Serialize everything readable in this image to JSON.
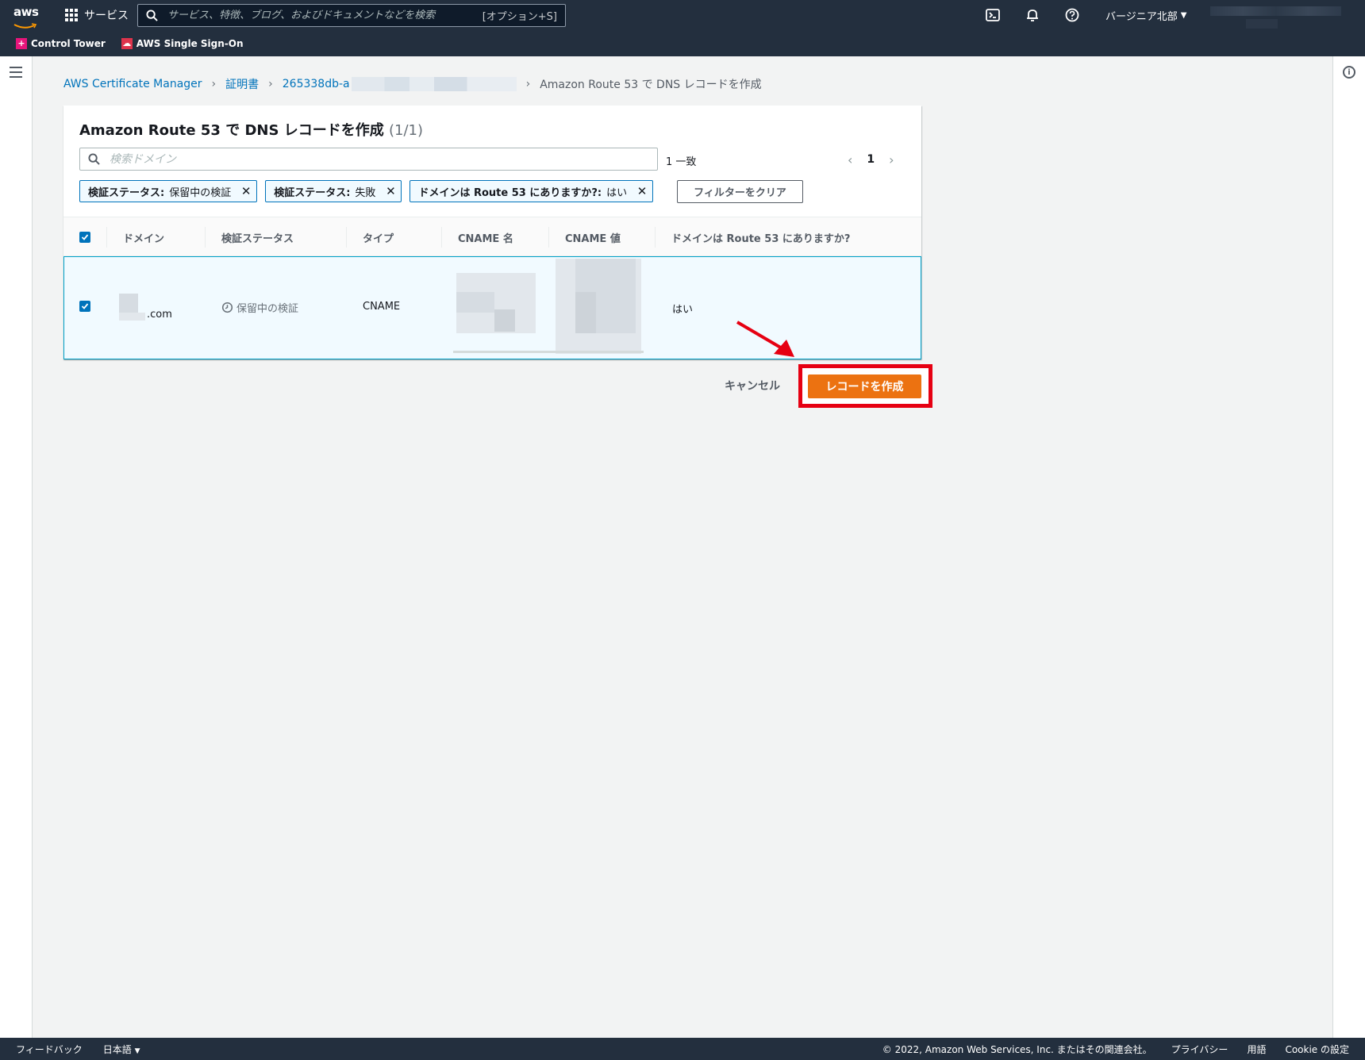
{
  "topnav": {
    "logo": "aws",
    "services_label": "サービス",
    "search_placeholder": "サービス、特徴、ブログ、およびドキュメントなどを検索",
    "search_shortcut": "[オプション+S]",
    "region": "バージニア北部",
    "icons": [
      "cloudshell-icon",
      "bell-icon",
      "help-icon"
    ]
  },
  "favorites": [
    {
      "label": "Control Tower",
      "color": "#e7157b"
    },
    {
      "label": "AWS Single Sign-On",
      "color": "#dd344c"
    }
  ],
  "breadcrumb": {
    "items": [
      "AWS Certificate Manager",
      "証明書",
      "265338db-a"
    ],
    "current": "Amazon Route 53 で DNS レコードを作成"
  },
  "panel": {
    "title": "Amazon Route 53 で DNS レコードを作成",
    "count": "(1/1)",
    "search_placeholder": "検索ドメイン",
    "match_count": "1 一致",
    "page": "1",
    "filters": [
      {
        "key": "検証ステータス:",
        "value": "保留中の検証"
      },
      {
        "key": "検証ステータス:",
        "value": "失敗"
      },
      {
        "key": "ドメインは Route 53 にありますか?:",
        "value": "はい"
      }
    ],
    "clear_filters": "フィルターをクリア"
  },
  "table": {
    "headers": [
      "ドメイン",
      "検証ステータス",
      "タイプ",
      "CNAME 名",
      "CNAME 値",
      "ドメインは Route 53 にありますか?"
    ],
    "rows": [
      {
        "domain_suffix": ".com",
        "status": "保留中の検証",
        "type": "CNAME",
        "in_route53": "はい"
      }
    ]
  },
  "actions": {
    "cancel": "キャンセル",
    "create": "レコードを作成"
  },
  "footer": {
    "feedback": "フィードバック",
    "language": "日本語",
    "copyright": "© 2022, Amazon Web Services, Inc. またはその関連会社。",
    "privacy": "プライバシー",
    "terms": "用語",
    "cookie": "Cookie の設定"
  },
  "colors": {
    "nav_bg": "#232f3e",
    "primary": "#ec7211",
    "link": "#0073bb",
    "highlight": "#e60012"
  }
}
